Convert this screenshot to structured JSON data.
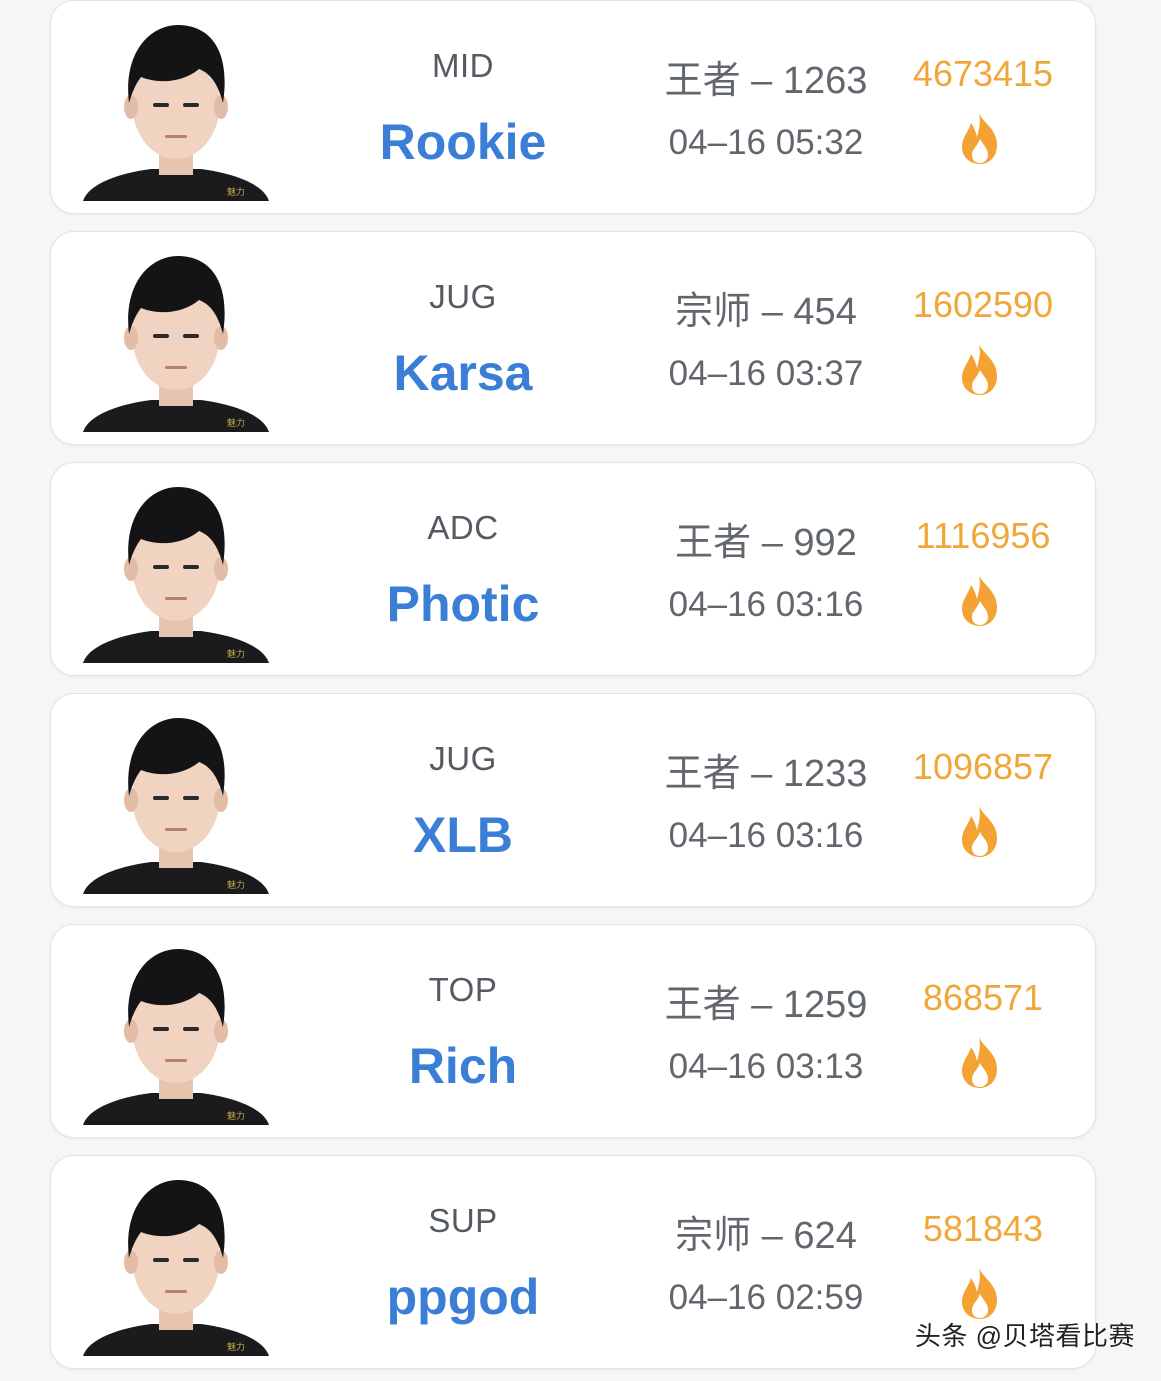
{
  "colors": {
    "background": "#f6f6f7",
    "card": "#ffffff",
    "name": "#3a7ed6",
    "score": "#f0a73a",
    "text": "#62666d",
    "fire": "#f4a233"
  },
  "players": [
    {
      "position": "MID",
      "name": "Rookie",
      "rank": "王者 – 1263",
      "time": "04–16 05:32",
      "score": "4673415",
      "icon": "fire-icon"
    },
    {
      "position": "JUG",
      "name": "Karsa",
      "rank": "宗师 – 454",
      "time": "04–16 03:37",
      "score": "1602590",
      "icon": "fire-icon"
    },
    {
      "position": "ADC",
      "name": "Photic",
      "rank": "王者 – 992",
      "time": "04–16 03:16",
      "score": "1116956",
      "icon": "fire-icon"
    },
    {
      "position": "JUG",
      "name": "XLB",
      "rank": "王者 – 1233",
      "time": "04–16 03:16",
      "score": "1096857",
      "icon": "fire-icon"
    },
    {
      "position": "TOP",
      "name": "Rich",
      "rank": "王者 – 1259",
      "time": "04–16 03:13",
      "score": "868571",
      "icon": "fire-icon"
    },
    {
      "position": "SUP",
      "name": "ppgod",
      "rank": "宗师 – 624",
      "time": "04–16 02:59",
      "score": "581843",
      "icon": "fire-icon"
    }
  ],
  "watermark": "头条 @贝塔看比赛"
}
